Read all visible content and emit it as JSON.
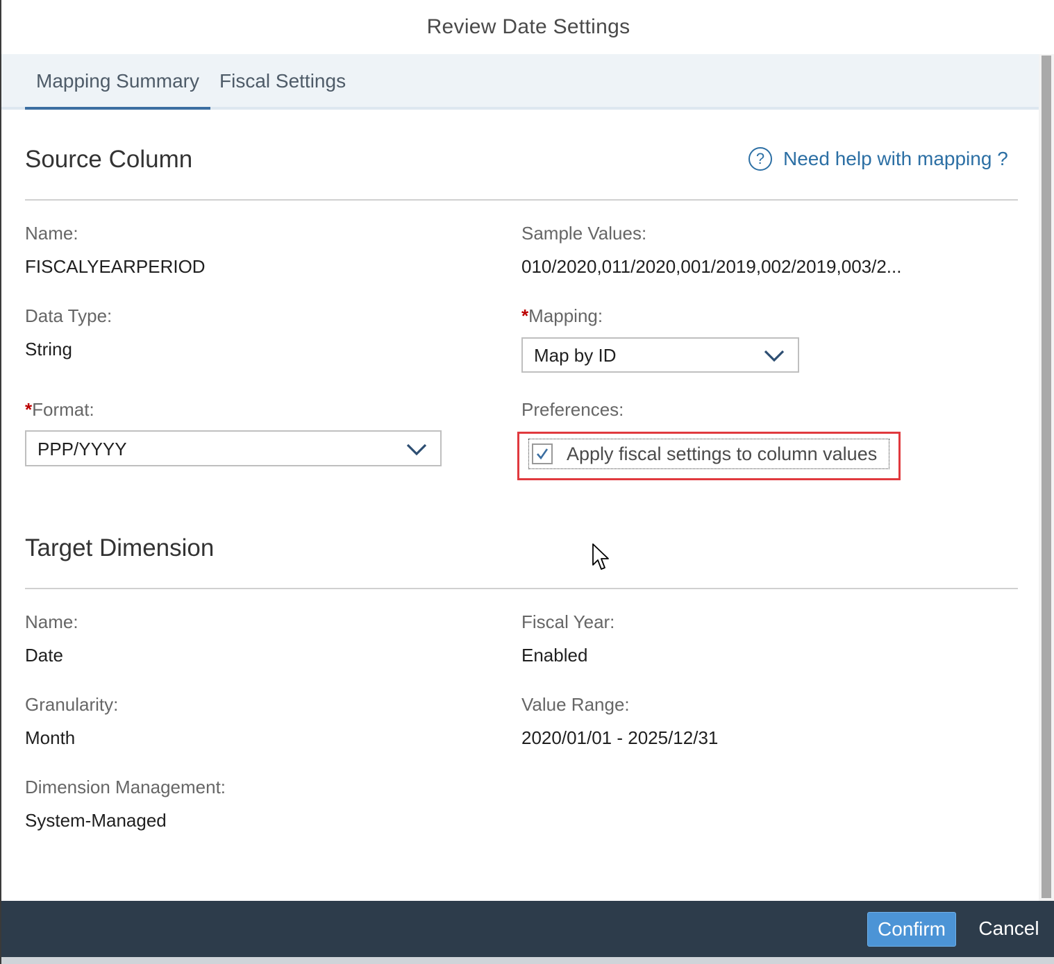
{
  "dialog": {
    "title": "Review Date Settings"
  },
  "tabs": [
    {
      "label": "Mapping Summary",
      "active": true
    },
    {
      "label": "Fiscal Settings",
      "active": false
    }
  ],
  "source": {
    "heading": "Source Column",
    "help_link": "Need help with mapping ?",
    "name_label": "Name:",
    "name_value": "FISCALYEARPERIOD",
    "sample_label": "Sample Values:",
    "sample_value": "010/2020,011/2020,001/2019,002/2019,003/2...",
    "datatype_label": "Data Type:",
    "datatype_value": "String",
    "mapping_required": "*",
    "mapping_label": "Mapping:",
    "mapping_value": "Map by ID",
    "format_required": "*",
    "format_label": "Format:",
    "format_value": "PPP/YYYY",
    "preferences_label": "Preferences:",
    "apply_fiscal_label": "Apply fiscal settings to column values",
    "apply_fiscal_checked": true
  },
  "target": {
    "heading": "Target Dimension",
    "name_label": "Name:",
    "name_value": "Date",
    "fiscal_year_label": "Fiscal Year:",
    "fiscal_year_value": "Enabled",
    "granularity_label": "Granularity:",
    "granularity_value": "Month",
    "value_range_label": "Value Range:",
    "value_range_value": "2020/01/01 - 2025/12/31",
    "dim_mgmt_label": "Dimension Management:",
    "dim_mgmt_value": "System-Managed"
  },
  "footer": {
    "confirm_label": "Confirm",
    "cancel_label": "Cancel"
  },
  "colors": {
    "accent": "#3b6ea1",
    "link": "#2c6fa4",
    "required": "#bb0000",
    "highlight": "#e0393e",
    "footer_bg": "#2d3c4b",
    "confirm_bg": "#4c94d6"
  },
  "icons": {
    "help": "question-circle-icon",
    "dropdown": "chevron-down-icon",
    "check": "checkmark-icon",
    "cursor": "mouse-pointer-icon"
  }
}
